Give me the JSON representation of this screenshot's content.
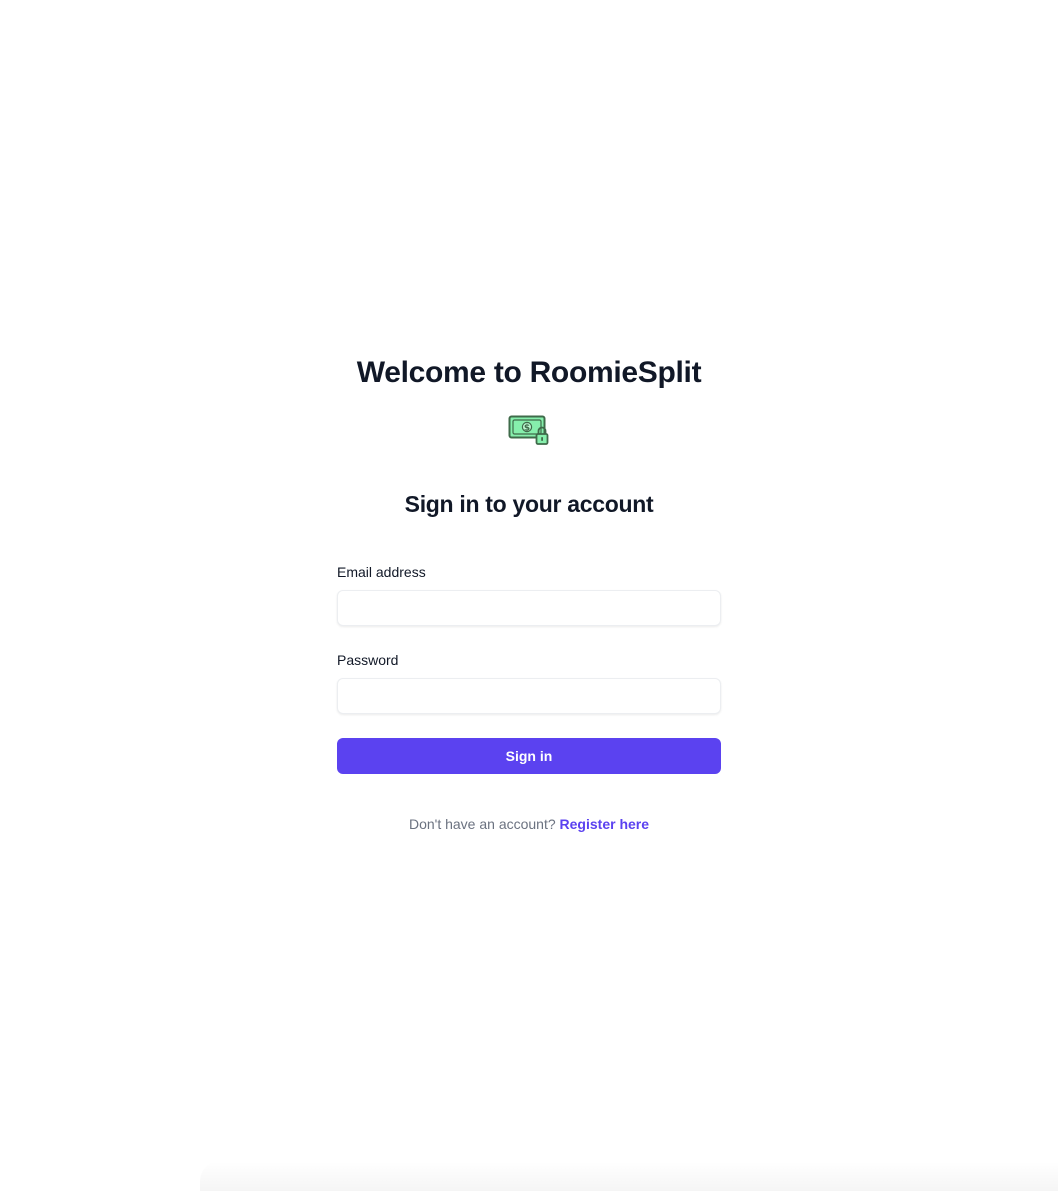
{
  "header": {
    "welcome_title": "Welcome to RoomieSplit",
    "logo_icon": "money-lock-icon"
  },
  "form": {
    "title": "Sign in to your account",
    "email_label": "Email address",
    "email_value": "",
    "email_placeholder": "",
    "password_label": "Password",
    "password_value": "",
    "password_placeholder": "",
    "submit_label": "Sign in"
  },
  "footer": {
    "prompt_text": "Don't have an account?",
    "register_link_label": "Register here"
  },
  "colors": {
    "accent": "#5b42f0",
    "heading": "#111827",
    "muted_text": "#6b7280",
    "logo_green": "#86efac",
    "logo_dark_green": "#3f6b4a"
  }
}
